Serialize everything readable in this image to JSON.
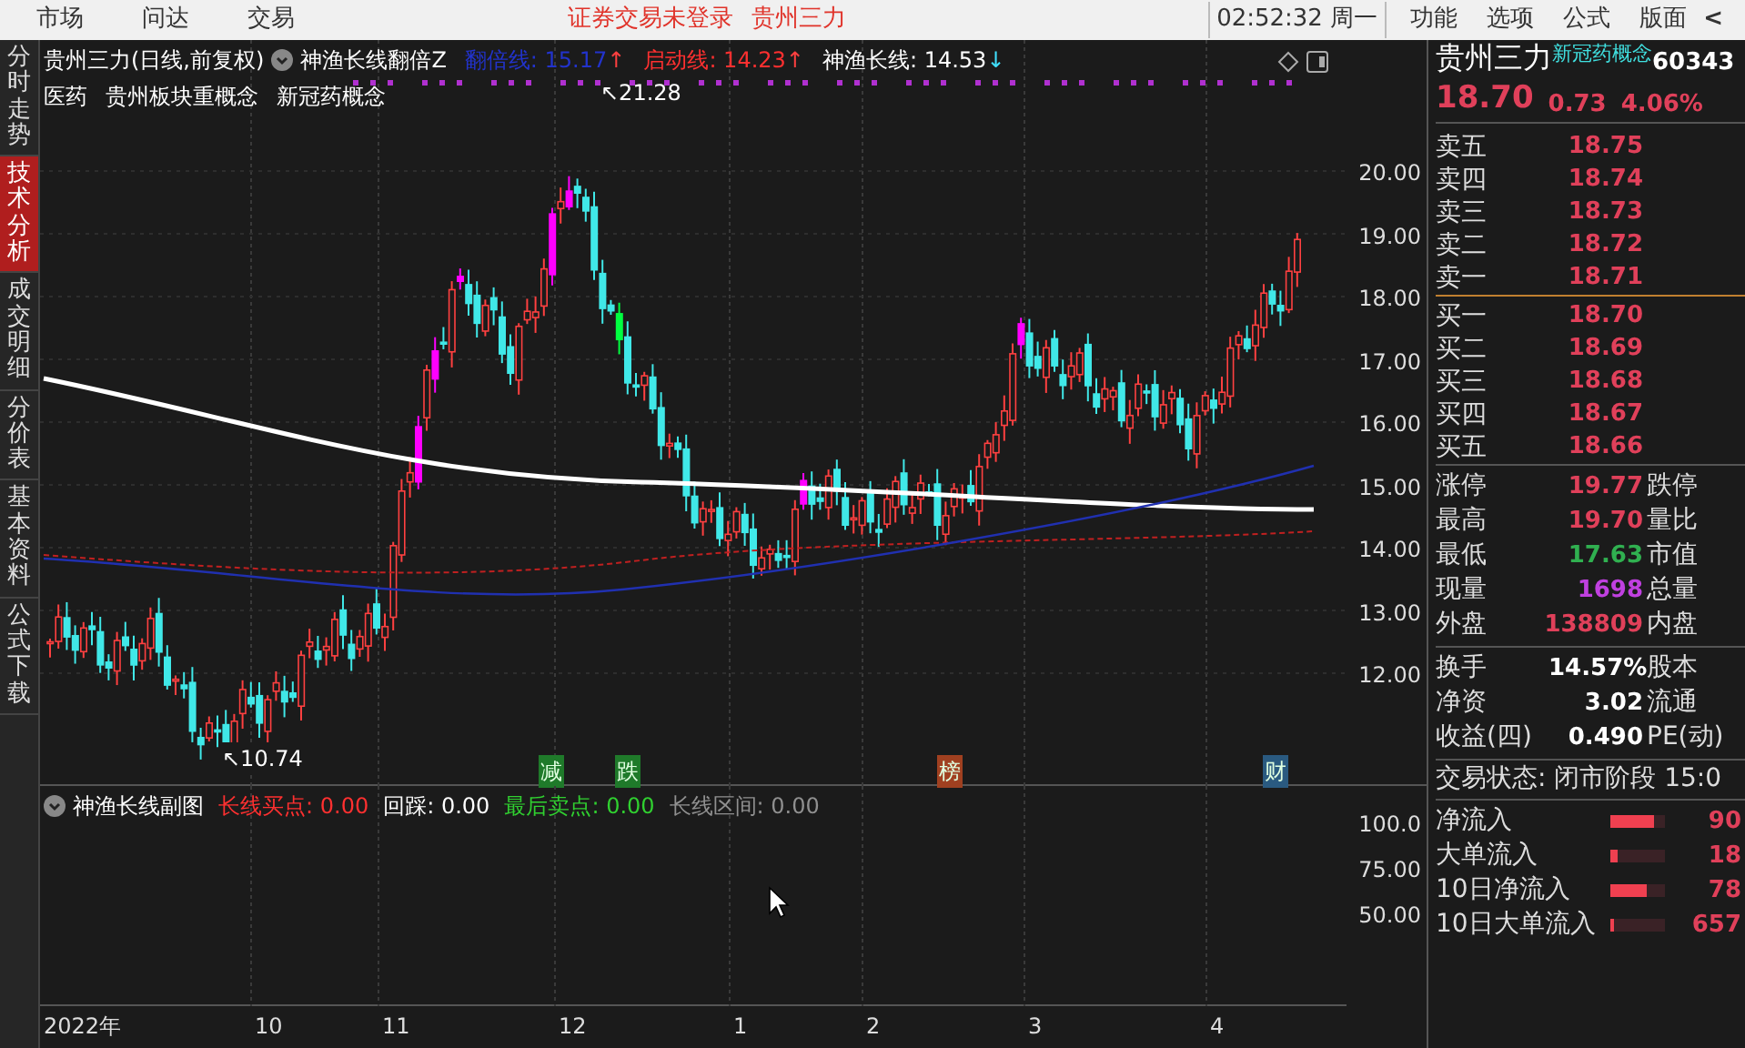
{
  "menu_bar": {
    "left_menus": [
      "市场",
      "问达",
      "交易"
    ],
    "notice": "证券交易未登录",
    "stock": "贵州三力",
    "clock": "02:52:32 周一",
    "right_menus": [
      "功能",
      "选项",
      "公式",
      "版面"
    ],
    "collapse": "<"
  },
  "side_tabs": [
    {
      "label": "分时走势",
      "selected": false
    },
    {
      "label": "技术分析",
      "selected": true
    },
    {
      "label": "成交明细",
      "selected": false
    },
    {
      "label": "分价表",
      "selected": false
    },
    {
      "label": "基本资料",
      "selected": false
    },
    {
      "label": "公式下载",
      "selected": false
    }
  ],
  "main_chart": {
    "title": "贵州三力(日线,前复权)",
    "indicator": "神渔长线翻倍Z",
    "readings": [
      {
        "label": "翻倍线: 15.17",
        "color": "#2233cc",
        "arrow": {
          "text": "↑",
          "color": "#ff4040"
        }
      },
      {
        "label": "启动线: 14.23",
        "color": "#ff3030",
        "arrow": {
          "text": "↑",
          "color": "#ff4040"
        }
      },
      {
        "label": "神渔长线: 14.53",
        "color": "#ffffff",
        "arrow": {
          "text": "↓",
          "color": "#40e0ff"
        }
      }
    ],
    "tags": [
      "医药",
      "贵州板块重概念",
      "新冠药概念"
    ],
    "high_label": "↖21.28",
    "low_label": "↖10.74",
    "markers": [
      {
        "text": "减",
        "color": "#1f7a2a"
      },
      {
        "text": "跌",
        "color": "#1f7a2a"
      },
      {
        "text": "榜",
        "color": "#a04020"
      },
      {
        "text": "财",
        "color": "#2a5a80"
      }
    ],
    "price_ticks": [
      "20.00",
      "19.00",
      "18.00",
      "17.00",
      "16.00",
      "15.00",
      "14.00",
      "13.00",
      "12.00"
    ]
  },
  "sub_chart": {
    "title": "神渔长线副图",
    "readings": [
      {
        "label": "长线买点:",
        "value": "0.00",
        "color": "#ff3030"
      },
      {
        "label": "回踩:",
        "value": "0.00",
        "color": "#ffffff"
      },
      {
        "label": "最后卖点:",
        "value": "0.00",
        "color": "#30d030"
      },
      {
        "label": "长线区间:",
        "value": "0.00",
        "color": "#909090"
      }
    ],
    "ticks": [
      "100.0",
      "75.00",
      "50.00"
    ]
  },
  "time_axis": [
    "2022年",
    "10",
    "11",
    "12",
    "1",
    "2",
    "3",
    "4"
  ],
  "quote": {
    "name": "贵州三力",
    "concept": "新冠药概念",
    "code": "60343",
    "price": "18.70",
    "change": "0.73",
    "percent": "4.06%",
    "sells": [
      {
        "label": "卖五",
        "price": "18.75"
      },
      {
        "label": "卖四",
        "price": "18.74"
      },
      {
        "label": "卖三",
        "price": "18.73"
      },
      {
        "label": "卖二",
        "price": "18.72"
      },
      {
        "label": "卖一",
        "price": "18.71"
      }
    ],
    "buys": [
      {
        "label": "买一",
        "price": "18.70"
      },
      {
        "label": "买二",
        "price": "18.69"
      },
      {
        "label": "买三",
        "price": "18.68"
      },
      {
        "label": "买四",
        "price": "18.67"
      },
      {
        "label": "买五",
        "price": "18.66"
      }
    ],
    "stats": [
      {
        "label": "涨停",
        "value": "19.77",
        "color": "#e0405a",
        "right": "跌停"
      },
      {
        "label": "最高",
        "value": "19.70",
        "color": "#e0405a",
        "right": "量比"
      },
      {
        "label": "最低",
        "value": "17.63",
        "color": "#30b050",
        "right": "市值"
      },
      {
        "label": "现量",
        "value": "1698",
        "color": "#c040e0",
        "right": "总量"
      },
      {
        "label": "外盘",
        "value": "138809",
        "color": "#e0405a",
        "right": "内盘"
      }
    ],
    "fundamentals": [
      {
        "label": "换手",
        "value": "14.57%",
        "right": "股本"
      },
      {
        "label": "净资",
        "value": "3.02",
        "right": "流通"
      },
      {
        "label": "收益(四)",
        "value": "0.490",
        "right": "PE(动)"
      }
    ],
    "status": "交易状态: 闭市阶段 15:0",
    "flows": [
      {
        "label": "净流入",
        "level": 0.8,
        "value": "90"
      },
      {
        "label": "大单流入",
        "level": 0.12,
        "value": "18"
      },
      {
        "label": "10日净流入",
        "level": 0.65,
        "value": "78"
      },
      {
        "label": "10日大单流入",
        "level": 0.05,
        "value": "657"
      }
    ]
  }
}
